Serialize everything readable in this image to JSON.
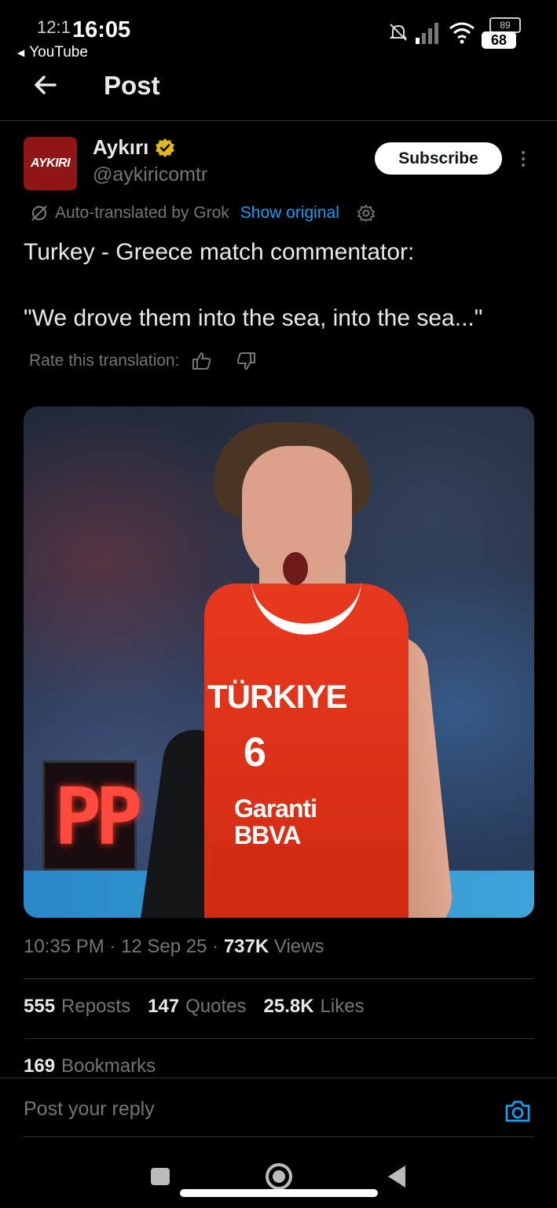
{
  "status_bar": {
    "time_secondary": "12:1",
    "time": "16:05",
    "back_app": "YouTube",
    "battery_small": "89",
    "battery": "68"
  },
  "header": {
    "title": "Post"
  },
  "author": {
    "avatar_text": "AYKIRI",
    "name": "Aykırı",
    "handle": "@aykiricomtr",
    "subscribe_label": "Subscribe",
    "verified_color": "#e2b719"
  },
  "translation": {
    "label": "Auto-translated by Grok",
    "show_original": "Show original"
  },
  "post": {
    "text": "Turkey - Greece match commentator:\n\n\"We drove them into the sea, into the sea...\""
  },
  "rate": {
    "label": "Rate this translation:"
  },
  "media": {
    "shot_clock": "PP",
    "jersey_text": "TÜRKIYE",
    "jersey_number": "6",
    "sponsor_line1": "Garanti",
    "sponsor_line2": "BBVA"
  },
  "meta": {
    "time": "10:35 PM",
    "date": "12 Sep 25",
    "views_count": "737K",
    "views_label": "Views"
  },
  "stats": {
    "reposts_count": "555",
    "reposts_label": "Reposts",
    "quotes_count": "147",
    "quotes_label": "Quotes",
    "likes_count": "25.8K",
    "likes_label": "Likes",
    "bookmarks_count": "169",
    "bookmarks_label": "Bookmarks"
  },
  "reply": {
    "placeholder": "Post your reply"
  },
  "colors": {
    "accent": "#1d9bf0",
    "muted": "#71767b",
    "text": "#e7e9ea",
    "background": "#000000"
  }
}
